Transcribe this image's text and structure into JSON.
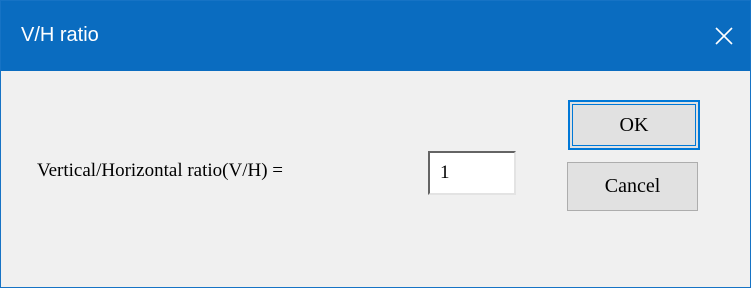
{
  "window": {
    "title": "V/H ratio",
    "close_glyph": "✕",
    "close_icon": "close-icon",
    "titlebar_color": "#0a6cc0",
    "body_color": "#f0f0f0"
  },
  "form": {
    "ratio_label": "Vertical/Horizontal ratio(V/H) =",
    "ratio_value": "1"
  },
  "buttons": {
    "ok_label": "OK",
    "cancel_label": "Cancel",
    "focus_color": "#0078d7"
  }
}
